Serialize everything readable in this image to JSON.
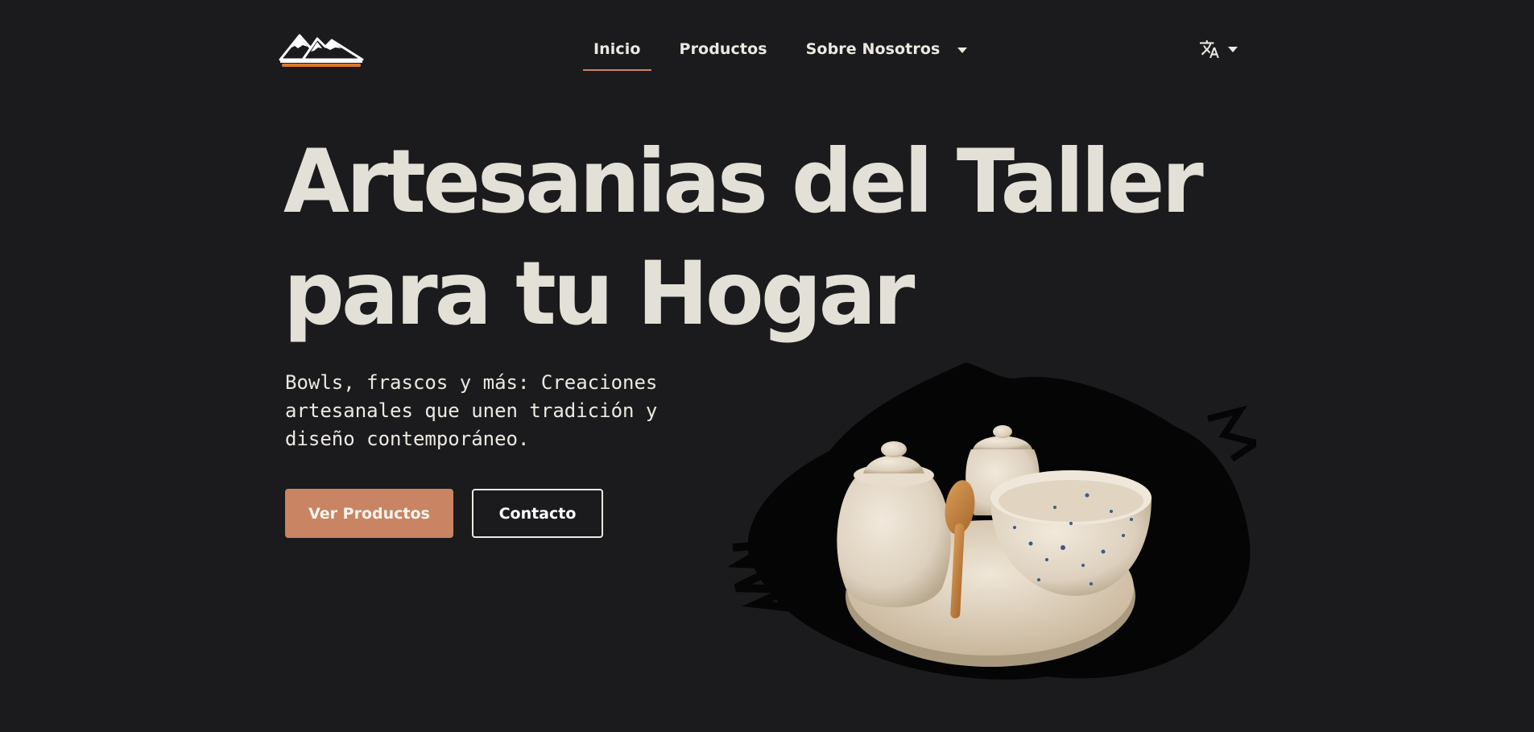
{
  "header": {
    "nav": [
      {
        "label": "Inicio",
        "active": true
      },
      {
        "label": "Productos",
        "active": false
      },
      {
        "label": "Sobre Nosotros",
        "active": false,
        "has_dropdown": true
      }
    ],
    "language_icon": "translate-icon"
  },
  "hero": {
    "title_line1": "Artesanias del Taller",
    "title_line2": "para tu Hogar",
    "subtitle": "Bowls, frascos y más: Creaciones artesanales que unen tradición y diseño contemporáneo.",
    "primary_button": "Ver Productos",
    "secondary_button": "Contacto"
  },
  "colors": {
    "background": "#1b1b1d",
    "accent": "#c88463",
    "text": "#ece9e2"
  }
}
